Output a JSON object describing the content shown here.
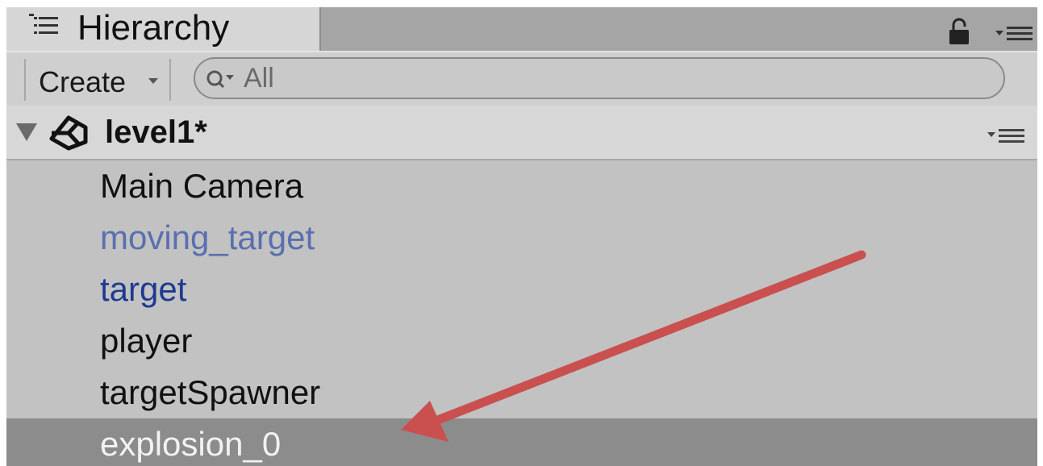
{
  "tab": {
    "title": "Hierarchy",
    "icon": "hierarchy-list-icon"
  },
  "toolbar": {
    "create_label": "Create",
    "search": {
      "placeholder": "All",
      "value": ""
    }
  },
  "scene": {
    "name": "level1*",
    "icon": "unity-logo-icon",
    "expanded": true
  },
  "items": [
    {
      "label": "Main Camera",
      "color": "#111111",
      "selected": false
    },
    {
      "label": "moving_target",
      "color": "#5a6fae",
      "selected": false
    },
    {
      "label": "target",
      "color": "#1f3a93",
      "selected": false
    },
    {
      "label": "player",
      "color": "#111111",
      "selected": false
    },
    {
      "label": "targetSpawner",
      "color": "#111111",
      "selected": false
    },
    {
      "label": "explosion_0",
      "color": "#f2f2f2",
      "selected": true
    }
  ],
  "colors": {
    "panel_bg": "#c2c2c2",
    "selected_bg": "#8c8c8c",
    "annotation_arrow": "#c9504f"
  }
}
